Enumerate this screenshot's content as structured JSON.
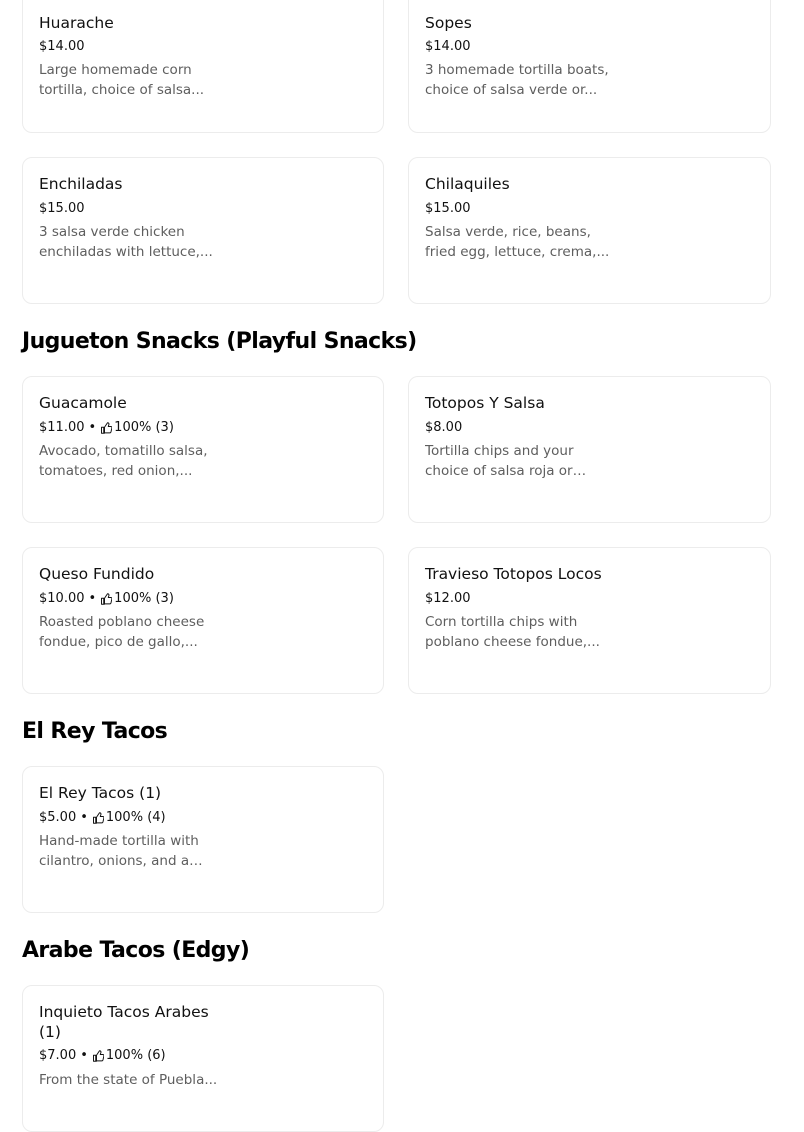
{
  "colors": {
    "text": "#111111",
    "muted": "#5e5e5e",
    "border": "#ececec",
    "background": "#ffffff"
  },
  "icons": {
    "rating": "thumbs-up-icon"
  },
  "meta_separator": "•",
  "sections": [
    {
      "title": ""
    },
    {
      "title": "Jugueton Snacks (Playful Snacks)"
    },
    {
      "title": "El Rey Tacos"
    },
    {
      "title": "Arabe Tacos (Edgy)"
    }
  ],
  "items": [
    {
      "name": "Huarache",
      "price": "$14.00",
      "rating": "",
      "description": "Large homemade corn tortilla, choice of salsa..."
    },
    {
      "name": "Sopes",
      "price": "$14.00",
      "rating": "",
      "description": "3 homemade tortilla boats, choice of salsa verde or..."
    },
    {
      "name": "Enchiladas",
      "price": "$15.00",
      "rating": "",
      "description": "3 salsa verde chicken enchiladas with lettuce,..."
    },
    {
      "name": "Chilaquiles",
      "price": "$15.00",
      "rating": "",
      "description": "Salsa verde, rice, beans, fried egg, lettuce, crema,..."
    },
    {
      "name": "Guacamole",
      "price": "$11.00",
      "rating": "100% (3)",
      "description": "Avocado, tomatillo salsa, tomatoes, red onion,..."
    },
    {
      "name": "Totopos Y Salsa",
      "price": "$8.00",
      "rating": "",
      "description": "Tortilla chips and your choice of salsa roja or sals..."
    },
    {
      "name": "Queso Fundido",
      "price": "$10.00",
      "rating": "100% (3)",
      "description": "Roasted poblano cheese fondue, pico de gallo,..."
    },
    {
      "name": "Travieso Totopos Locos",
      "price": "$12.00",
      "rating": "",
      "description": "Corn tortilla chips with poblano cheese fondue,..."
    },
    {
      "name": "El Rey Tacos (1)",
      "price": "$5.00",
      "rating": "100% (4)",
      "description": "Hand-made tortilla with cilantro, onions, and a side..."
    },
    {
      "name": "Inquieto Tacos Arabes (1)",
      "price": "$7.00",
      "rating": "100% (6)",
      "description": "From the state of Puebla..."
    }
  ]
}
